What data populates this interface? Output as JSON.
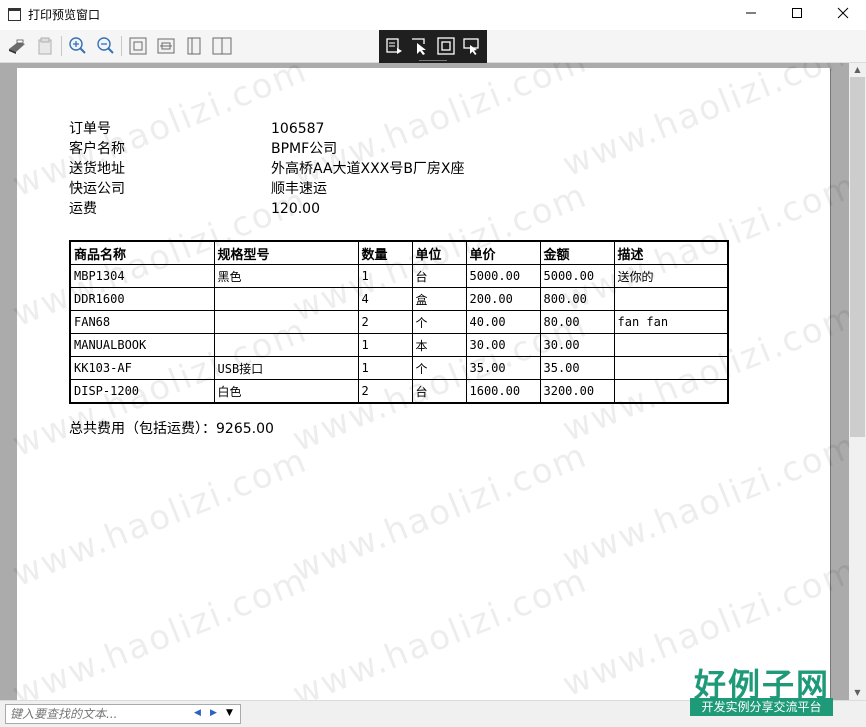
{
  "window": {
    "title": "打印预览窗口",
    "minimize": "—",
    "maximize": "☐",
    "close": "✕"
  },
  "toolbar": {
    "icons": [
      "print-icon",
      "page-setup-icon",
      "zoom-in-icon",
      "zoom-out-icon",
      "fit-page-icon",
      "fit-width-icon",
      "single-page-icon",
      "two-page-icon"
    ],
    "float_icons": [
      "thumbnail-icon",
      "select-cursor-icon",
      "fit-icon",
      "pan-cursor-icon"
    ]
  },
  "document": {
    "fields": [
      {
        "label": "订单号",
        "value": "106587"
      },
      {
        "label": "客户名称",
        "value": "BPMF公司"
      },
      {
        "label": "送货地址",
        "value": "外高桥AA大道XXX号B厂房X座"
      },
      {
        "label": "快运公司",
        "value": "顺丰速运"
      },
      {
        "label": "运费",
        "value": "120.00"
      }
    ],
    "table": {
      "headers": [
        "商品名称",
        "规格型号",
        "数量",
        "单位",
        "单价",
        "金额",
        "描述"
      ],
      "rows": [
        [
          "MBP1304",
          "黑色",
          "1",
          "台",
          "5000.00",
          "5000.00",
          "送你的"
        ],
        [
          "DDR1600",
          "",
          "4",
          "盒",
          "200.00",
          "800.00",
          ""
        ],
        [
          "FAN68",
          "",
          "2",
          "个",
          "40.00",
          "80.00",
          "fan fan"
        ],
        [
          "MANUALBOOK",
          "",
          "1",
          "本",
          "30.00",
          "30.00",
          ""
        ],
        [
          "KK103-AF",
          "USB接口",
          "1",
          "个",
          "35.00",
          "35.00",
          ""
        ],
        [
          "DISP-1200",
          "白色",
          "2",
          "台",
          "1600.00",
          "3200.00",
          ""
        ]
      ]
    },
    "total": "总共费用（包括运费）：9265.00"
  },
  "watermark": "www.haolizi.com",
  "search": {
    "placeholder": "键入要查找的文本...",
    "prev": "◀",
    "next": "▶",
    "dropdown": "▼"
  },
  "logo": {
    "main": "好例子网",
    "sub": "开发实例分享交流平台"
  }
}
